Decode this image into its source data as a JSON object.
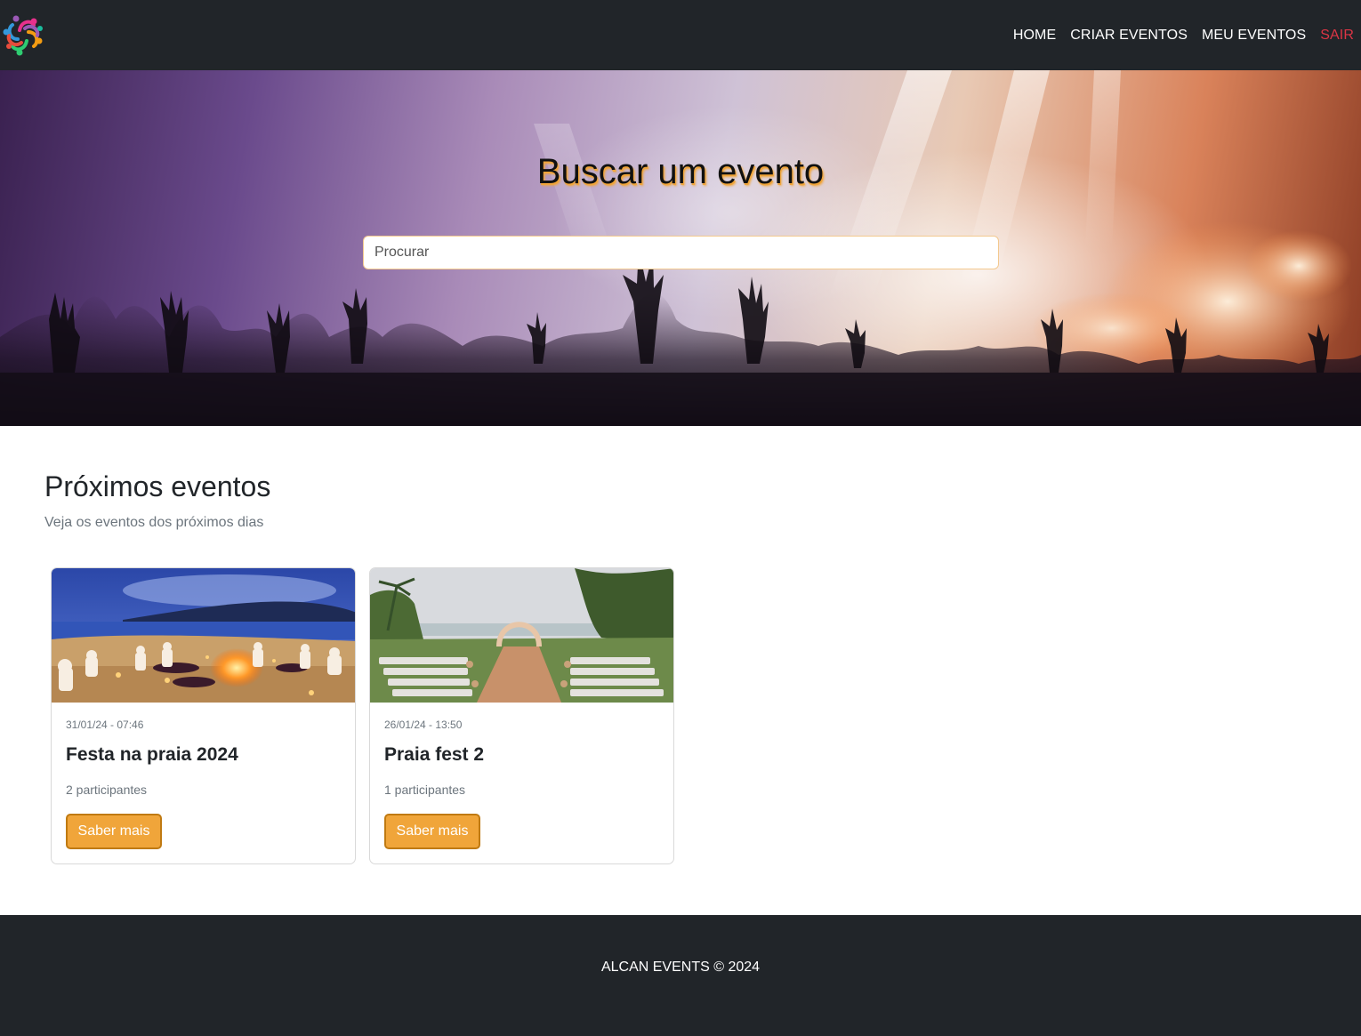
{
  "navbar": {
    "logo_icon": "people-circle-logo-icon",
    "links": [
      {
        "label": "HOME"
      },
      {
        "label": "CRIAR EVENTOS"
      },
      {
        "label": "MEU EVENTOS"
      },
      {
        "label": "SAIR",
        "color": "#dc3545"
      }
    ]
  },
  "hero": {
    "title": "Buscar um evento",
    "search_placeholder": "Procurar",
    "search_value": ""
  },
  "section": {
    "title": "Próximos eventos",
    "subtitle": "Veja os eventos dos próximos dias"
  },
  "events": [
    {
      "date": "31/01/24 - 07:46",
      "title": "Festa na praia 2024",
      "participants": "2 participantes",
      "button": "Saber mais",
      "image": "beach-bonfire-party-image"
    },
    {
      "date": "26/01/24 - 13:50",
      "title": "Praia fest 2",
      "participants": "1 participantes",
      "button": "Saber mais",
      "image": "beach-wedding-ceremony-image"
    }
  ],
  "footer": {
    "text": "ALCAN EVENTS © 2024"
  },
  "colors": {
    "navbar_bg": "#212529",
    "accent_button": "#f0a53a",
    "logout_link": "#dc3545",
    "footer_bg": "#212529"
  }
}
